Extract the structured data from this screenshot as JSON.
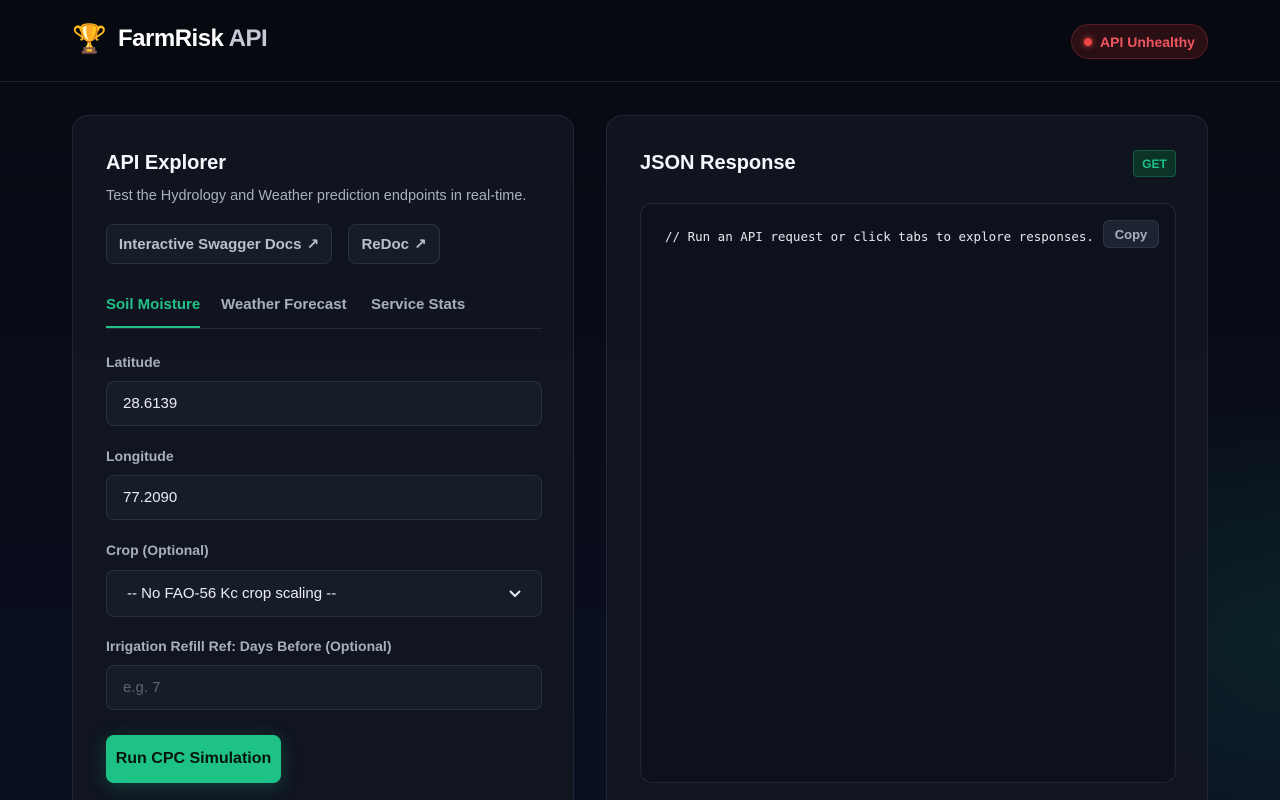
{
  "header": {
    "brand_primary": "FarmRisk",
    "brand_secondary": " API",
    "logo_icon": "trophy-icon",
    "status_label": "API Unhealthy",
    "status_color": "#ef4444"
  },
  "explorer": {
    "title": "API Explorer",
    "subtitle": "Test the Hydrology and Weather prediction endpoints in real-time.",
    "links": [
      {
        "label": "Interactive Swagger Docs",
        "icon": "↗"
      },
      {
        "label": "ReDoc",
        "icon": "↗"
      }
    ],
    "tabs": [
      {
        "label": "Soil Moisture",
        "active": true
      },
      {
        "label": "Weather Forecast",
        "active": false
      },
      {
        "label": "Service Stats",
        "active": false
      }
    ],
    "fields": {
      "latitude": {
        "label": "Latitude",
        "value": "28.6139"
      },
      "longitude": {
        "label": "Longitude",
        "value": "77.2090"
      },
      "crop": {
        "label": "Crop (Optional)",
        "selected": "-- No FAO-56 Kc crop scaling --"
      },
      "refill": {
        "label": "Irrigation Refill Ref: Days Before (Optional)",
        "value": "",
        "placeholder": "e.g. 7"
      }
    },
    "run_label": "Run CPC Simulation",
    "accent_color": "#1ec186"
  },
  "response": {
    "title": "JSON Response",
    "method": "GET",
    "code": "// Run an API request or click tabs to explore responses.",
    "copy_label": "Copy"
  }
}
